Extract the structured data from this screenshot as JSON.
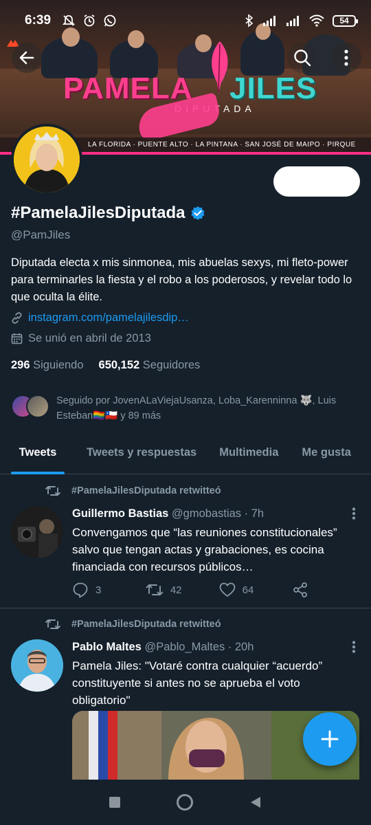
{
  "status_bar": {
    "time": "6:39",
    "battery": "54"
  },
  "banner": {
    "logo_first": "PAMELA",
    "logo_second": "JILES",
    "logo_sub": "DIPUTADA",
    "districts": "LA FLORIDA · PUENTE ALTO · LA PINTANA · SAN JOSÉ DE MAIPO · PIRQUE"
  },
  "profile": {
    "display_name": "#PamelaJilesDiputada",
    "handle": "@PamJiles",
    "bio": "Diputada electa x mis sinmonea, mis abuelas sexys, mi fleto-power para terminarles la fiesta y el robo a los poderosos, y revelar todo lo que oculta la élite.",
    "link": "instagram.com/pamelajilesdip…",
    "joined": "Se unió en abril de 2013",
    "following_count": "296",
    "following_label": "Siguiendo",
    "followers_count": "650,152",
    "followers_label": "Seguidores",
    "followed_by": "Seguido por JovenALaViejaUsanza, Loba_Karenninna 🐺, Luis Esteban🏳️‍🌈🇨🇱 y 89 más",
    "verified_color": "#1d9bf0"
  },
  "tabs": [
    {
      "label": "Tweets",
      "active": true
    },
    {
      "label": "Tweets y respuestas",
      "active": false
    },
    {
      "label": "Multimedia",
      "active": false
    },
    {
      "label": "Me gusta",
      "active": false
    }
  ],
  "tweets": [
    {
      "retweet_label": "#PamelaJilesDiputada retwitteó",
      "author_name": "Guillermo Bastias",
      "author_handle": "@gmobastias",
      "time": "· 7h",
      "text": "Convengamos que “las reuniones constitucionales” salvo que tengan actas y grabaciones, es cocina financiada con recursos públicos…",
      "replies": "3",
      "retweets": "42",
      "likes": "64"
    },
    {
      "retweet_label": "#PamelaJilesDiputada retwitteó",
      "author_name": "Pablo Maltes",
      "author_handle": "@Pablo_Maltes",
      "time": "· 20h",
      "text": "Pamela Jiles: \"Votaré contra cualquier “acuerdo” constituyente si antes no se aprueba el voto obligatorio\""
    }
  ],
  "icons": {
    "back": "back-arrow-icon",
    "search": "search-icon",
    "more": "more-vertical-icon",
    "link": "link-icon",
    "calendar": "calendar-icon",
    "reply": "reply-icon",
    "retweet": "retweet-icon",
    "like": "heart-icon",
    "share": "share-icon",
    "compose": "plus-icon"
  },
  "colors": {
    "background": "#15202b",
    "accent": "#1d9bf0",
    "muted": "#8899a6",
    "divider": "#38444d"
  }
}
